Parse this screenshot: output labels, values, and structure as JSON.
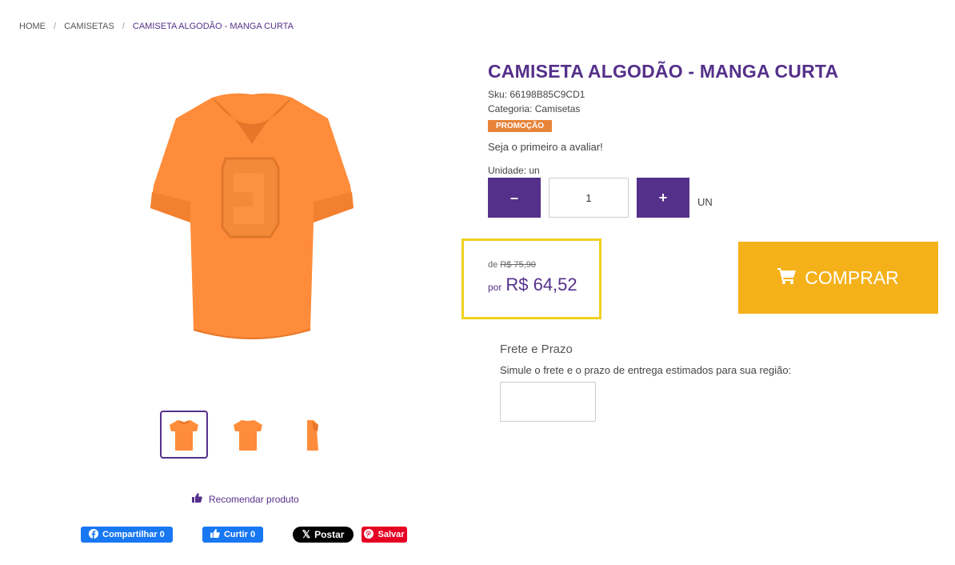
{
  "breadcrumb": [
    "HOME",
    "CAMISETAS",
    "CAMISETA ALGODÃO - MANGA CURTA"
  ],
  "product": {
    "title": "CAMISETA ALGODÃO - MANGA CURTA",
    "sku": "Sku: 66198B85C9CD1",
    "categoria": "Categoria: Camisetas",
    "badge": "PROMOÇÃO",
    "review": "Seja o primeiro a avaliar!",
    "unit_label": "Unidade: un",
    "quantity": "1",
    "unit": "UN",
    "minus_label": "–",
    "plus_label": "+"
  },
  "price": {
    "old_prefix": "de",
    "old_value": "R$ 75,90",
    "new_prefix": "por",
    "new_value": "R$ 64,52"
  },
  "buy": {
    "label": "COMPRAR",
    "color": "#f5b11a"
  },
  "frete": {
    "title": "Frete e Prazo",
    "description": "Simule o frete e o prazo de entrega estimados para sua região:"
  },
  "recommend_label": "Recomendar produto",
  "social": {
    "facebook_share": "Compartilhar 0",
    "facebook_like": "Curtir 0",
    "x_post": "Postar",
    "pinterest_save": "Salvar"
  },
  "colors": {
    "accent": "#55308a",
    "shirt": "#ff8c3a",
    "badge": "#e8833a",
    "highlight": "#f0d020"
  }
}
